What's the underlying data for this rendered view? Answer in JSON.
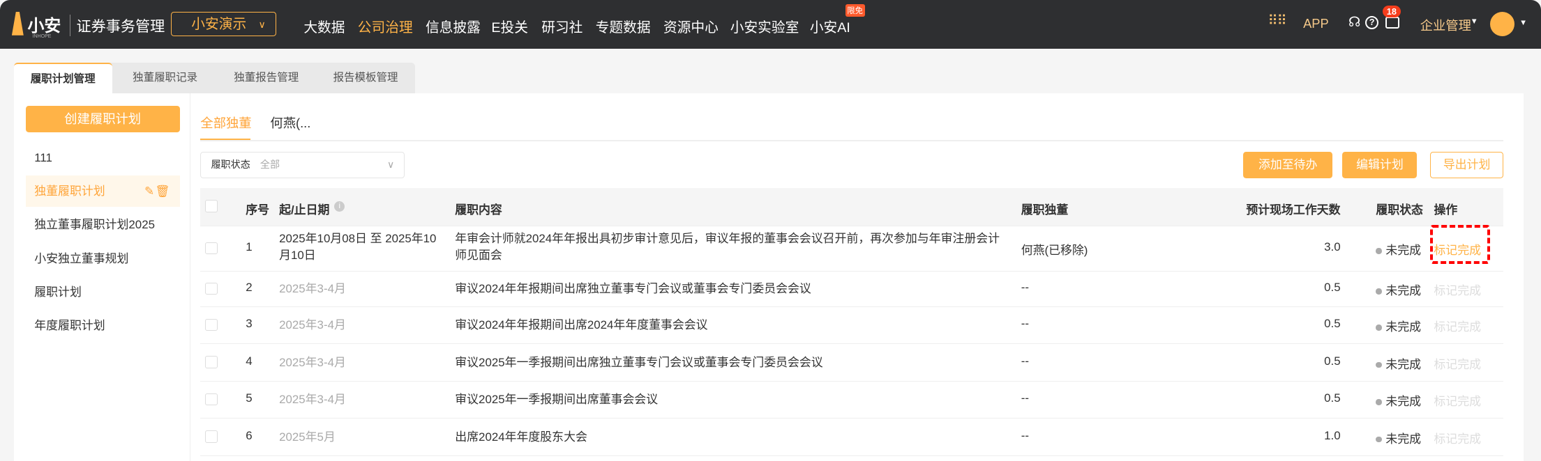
{
  "header": {
    "logo_text": "小安",
    "logo_sub": "INHOPE",
    "app_title": "证券事务管理",
    "company_select": "小安演示",
    "nav": [
      "大数据",
      "公司治理",
      "信息披露",
      "E投关",
      "研习社",
      "专题数据",
      "资源中心",
      "小安实验室",
      "小安AI"
    ],
    "ai_badge": "限免",
    "app_link": "APP",
    "notification_count": "18",
    "enterprise_menu": "企业管理",
    "accent": "#ffb347"
  },
  "page_tabs": [
    "履职计划管理",
    "独董履职记录",
    "独董报告管理",
    "报告模板管理"
  ],
  "sidebar": {
    "create_button": "创建履职计划",
    "items": [
      "111",
      "独董履职计划",
      "独立董事履职计划2025",
      "小安独立董事规划",
      "履职计划",
      "年度履职计划"
    ]
  },
  "main": {
    "sub_tabs": [
      "全部独董",
      "何燕(..."
    ],
    "filter": {
      "label": "履职状态",
      "value": "全部"
    },
    "buttons": {
      "add_todo": "添加至待办",
      "edit": "编辑计划",
      "export": "导出计划"
    },
    "table": {
      "headers": [
        "序号",
        "起/止日期",
        "履职内容",
        "履职独董",
        "预计现场工作天数",
        "履职状态",
        "操作"
      ],
      "rows": [
        {
          "no": "1",
          "date": "2025年10月08日 至 2025年10月10日",
          "content": "年审会计师就2024年年报出具初步审计意见后，审议年报的董事会会议召开前，再次参加与年审注册会计师见面会",
          "director": "何燕(已移除)",
          "days": "3.0",
          "status": "未完成",
          "action": "标记完成"
        },
        {
          "no": "2",
          "date": "2025年3-4月",
          "content": "审议2024年年报期间出席独立董事专门会议或董事会专门委员会会议",
          "director": "--",
          "days": "0.5",
          "status": "未完成",
          "action": "标记完成"
        },
        {
          "no": "3",
          "date": "2025年3-4月",
          "content": "审议2024年年报期间出席2024年年度董事会会议",
          "director": "--",
          "days": "0.5",
          "status": "未完成",
          "action": "标记完成"
        },
        {
          "no": "4",
          "date": "2025年3-4月",
          "content": "审议2025年一季报期间出席独立董事专门会议或董事会专门委员会会议",
          "director": "--",
          "days": "0.5",
          "status": "未完成",
          "action": "标记完成"
        },
        {
          "no": "5",
          "date": "2025年3-4月",
          "content": "审议2025年一季报期间出席董事会会议",
          "director": "--",
          "days": "0.5",
          "status": "未完成",
          "action": "标记完成"
        },
        {
          "no": "6",
          "date": "2025年5月",
          "content": "出席2024年年度股东大会",
          "director": "--",
          "days": "1.0",
          "status": "未完成",
          "action": "标记完成"
        }
      ]
    }
  }
}
